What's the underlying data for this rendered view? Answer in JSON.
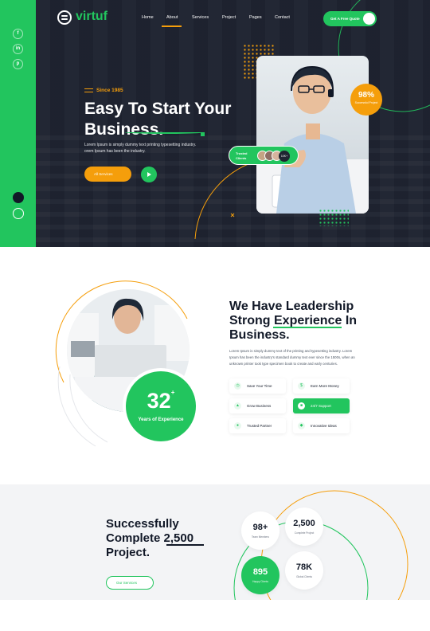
{
  "brand": {
    "name": "virtuf"
  },
  "social": [
    "f",
    "in",
    "p"
  ],
  "nav": {
    "items": [
      "Home",
      "About",
      "Services",
      "Project",
      "Pages",
      "Contact"
    ],
    "active": "About",
    "cta": "Get A Free Quote"
  },
  "hero": {
    "tagline": "Since 1985",
    "title": "Easy To Start Your Business.",
    "description": "Lorem Ipsum is simply dummy text printing typesetting industry. orem Ipsum has been the industry.",
    "button": "All Services",
    "badge_value": "98%",
    "badge_label": "Successful Project",
    "trusted_label": "Trusted Clients",
    "trusted_count": "10K+"
  },
  "about": {
    "title": "We Have Leadership Strong Experience In Business.",
    "description": "Lorem Ipsum is simply dummy text of the printing and typesetting industry. Lorem Ipsum has been the industry's standard dummy text ever since the 1500s, when an unknown printer took type specimen book to create and early centuries.",
    "features": [
      {
        "label": "Save Your Time",
        "icon": "clock-icon",
        "active": false
      },
      {
        "label": "Earn More Money",
        "icon": "money-icon",
        "active": false
      },
      {
        "label": "Grow Business",
        "icon": "chart-icon",
        "active": false
      },
      {
        "label": "24/7 Support",
        "icon": "support-icon",
        "active": true
      },
      {
        "label": "Trusted Partner",
        "icon": "handshake-icon",
        "active": false
      },
      {
        "label": "Innovative Ideas",
        "icon": "bulb-icon",
        "active": false
      }
    ],
    "years_value": "32",
    "years_sup": "+",
    "years_label": "Years of Experience"
  },
  "stats": {
    "title": "Successfully Complete 2,500 Project.",
    "button": "Our Services",
    "items": [
      {
        "value": "98+",
        "label": "Team Members"
      },
      {
        "value": "2,500",
        "label": "Complete Project"
      },
      {
        "value": "895",
        "label": "Happy Clients"
      },
      {
        "value": "78K",
        "label": "Global Clients"
      }
    ]
  },
  "colors": {
    "accent_green": "#22c55e",
    "accent_orange": "#f59e0b",
    "hero_bg": "#1f2431"
  }
}
